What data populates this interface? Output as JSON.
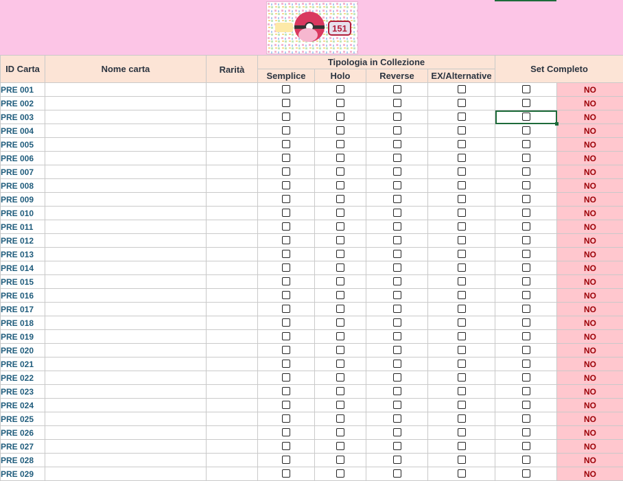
{
  "header": {
    "id": "ID Carta",
    "name": "Nome carta",
    "rarity": "Rarità",
    "group": "Tipologia in Collezione",
    "types": [
      "Semplice",
      "Holo",
      "Reverse",
      "EX/Alternative"
    ],
    "set": "Set Completo"
  },
  "logo": {
    "icon": "pokemon-151-logo-icon",
    "text": "151"
  },
  "colors": {
    "banner": "#fcc5e6",
    "header": "#fce4d6",
    "no_bg": "#ffc7ce",
    "no_text": "#9c0006",
    "id_text": "#1f5c7c"
  },
  "rows": [
    {
      "id": "PRE 001",
      "status": "NO"
    },
    {
      "id": "PRE 002",
      "status": "NO"
    },
    {
      "id": "PRE 003",
      "status": "NO"
    },
    {
      "id": "PRE 004",
      "status": "NO"
    },
    {
      "id": "PRE 005",
      "status": "NO"
    },
    {
      "id": "PRE 006",
      "status": "NO"
    },
    {
      "id": "PRE 007",
      "status": "NO"
    },
    {
      "id": "PRE 008",
      "status": "NO"
    },
    {
      "id": "PRE 009",
      "status": "NO"
    },
    {
      "id": "PRE 010",
      "status": "NO"
    },
    {
      "id": "PRE 011",
      "status": "NO"
    },
    {
      "id": "PRE 012",
      "status": "NO"
    },
    {
      "id": "PRE 013",
      "status": "NO"
    },
    {
      "id": "PRE 014",
      "status": "NO"
    },
    {
      "id": "PRE 015",
      "status": "NO"
    },
    {
      "id": "PRE 016",
      "status": "NO"
    },
    {
      "id": "PRE 017",
      "status": "NO"
    },
    {
      "id": "PRE 018",
      "status": "NO"
    },
    {
      "id": "PRE 019",
      "status": "NO"
    },
    {
      "id": "PRE 020",
      "status": "NO"
    },
    {
      "id": "PRE 021",
      "status": "NO"
    },
    {
      "id": "PRE 022",
      "status": "NO"
    },
    {
      "id": "PRE 023",
      "status": "NO"
    },
    {
      "id": "PRE 024",
      "status": "NO"
    },
    {
      "id": "PRE 025",
      "status": "NO"
    },
    {
      "id": "PRE 026",
      "status": "NO"
    },
    {
      "id": "PRE 027",
      "status": "NO"
    },
    {
      "id": "PRE 028",
      "status": "NO"
    },
    {
      "id": "PRE 029",
      "status": "NO"
    }
  ]
}
